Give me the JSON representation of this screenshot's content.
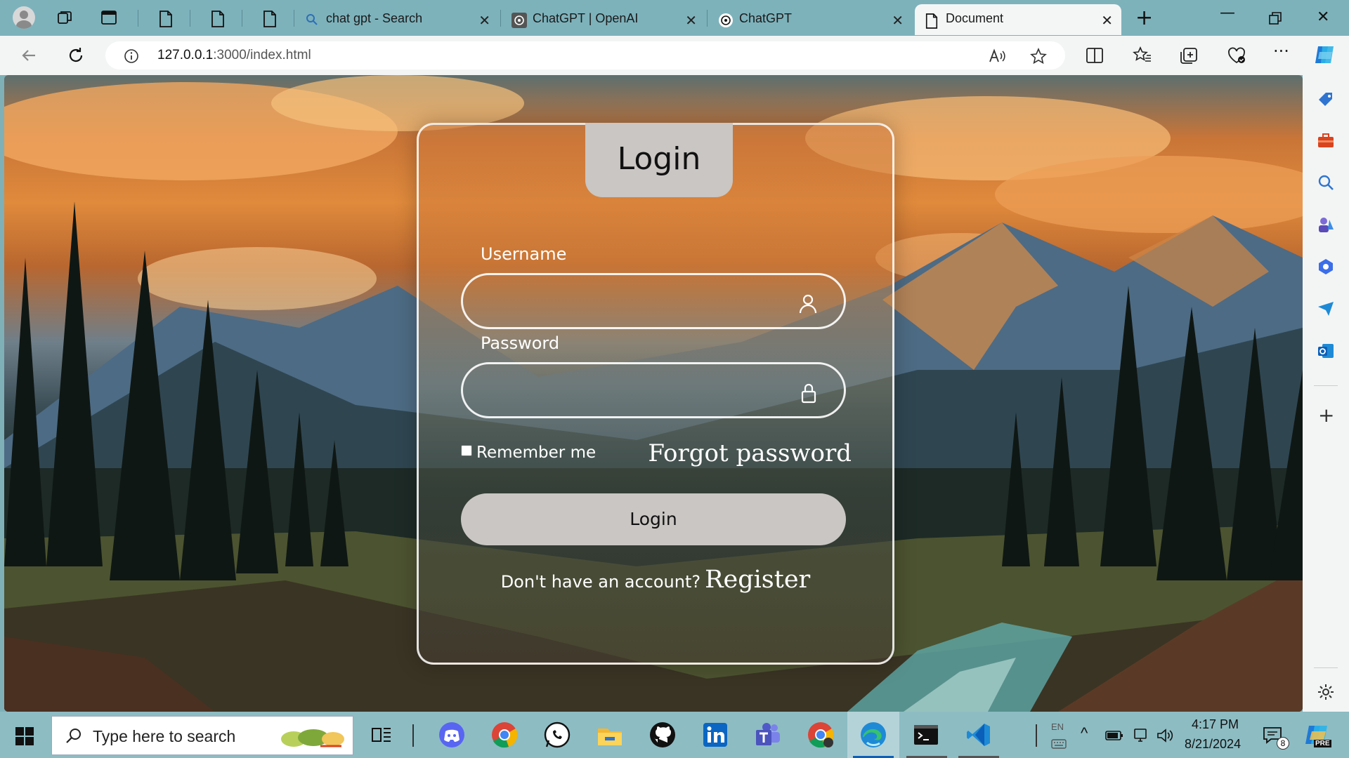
{
  "browser": {
    "tabs": [
      {
        "label": "chat gpt - Search",
        "icon": "search-icon"
      },
      {
        "label": "ChatGPT | OpenAI",
        "icon": "openai-icon"
      },
      {
        "label": "ChatGPT",
        "icon": "openai-icon"
      },
      {
        "label": "Document",
        "icon": "page-icon",
        "active": true
      }
    ],
    "url_host": "127.0.0.1",
    "url_rest": ":3000/index.html"
  },
  "login": {
    "title": "Login",
    "username_label": "Username",
    "password_label": "Password",
    "remember_label": "Remember me",
    "forgot_label": "Forgot password",
    "button_label": "Login",
    "register_prompt": "Don't have an account?",
    "register_label": "Register"
  },
  "taskbar": {
    "search_placeholder": "Type here to search",
    "language": "EN",
    "time": "4:17 PM",
    "date": "8/21/2024",
    "notification_count": "8",
    "copilot_badge": "PRE"
  },
  "colors": {
    "tabstrip": "#7db2bb",
    "taskbar": "#8dbcc3",
    "card_tab": "#c9c6c3",
    "accent": "#0b5fb8"
  }
}
